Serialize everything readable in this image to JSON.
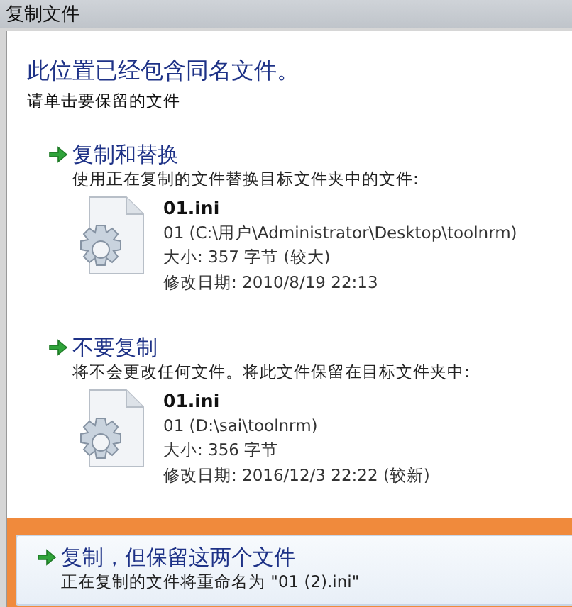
{
  "window": {
    "title": "复制文件"
  },
  "heading": "此位置已经包含同名文件。",
  "instruction": "请单击要保留的文件",
  "options": [
    {
      "title": "复制和替换",
      "description": "使用正在复制的文件替换目标文件夹中的文件:",
      "selected": false,
      "file": {
        "name": "01.ini",
        "location": "01 (C:\\用户\\Administrator\\Desktop\\toolnrm)",
        "size": "大小: 357 字节 (较大)",
        "modified": "修改日期: 2010/8/19 22:13"
      }
    },
    {
      "title": "不要复制",
      "description": "将不会更改任何文件。将此文件保留在目标文件夹中:",
      "selected": false,
      "file": {
        "name": "01.ini",
        "location": "01 (D:\\sai\\toolnrm)",
        "size": "大小: 356 字节",
        "modified": "修改日期: 2016/12/3 22:22 (较新)"
      }
    },
    {
      "title": "复制，但保留这两个文件",
      "description": "正在复制的文件将重命名为 \"01 (2).ini\"",
      "selected": true
    }
  ]
}
